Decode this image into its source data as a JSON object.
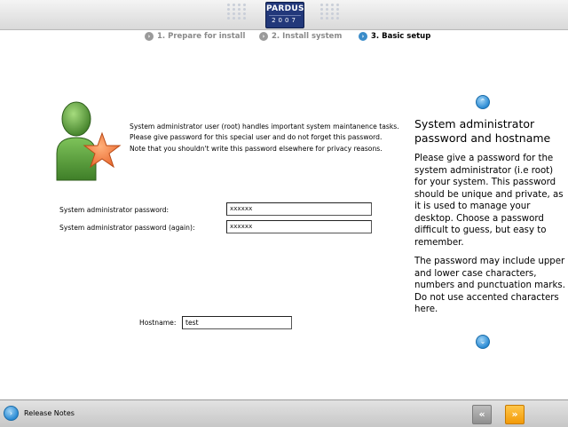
{
  "header": {
    "logo_name": "PARDUS",
    "logo_year": "2007"
  },
  "steps": [
    {
      "bullet": "›",
      "label": "1. Prepare for install"
    },
    {
      "bullet": "›",
      "label": "2. Install system"
    },
    {
      "bullet": "›",
      "label": "3. Basic setup"
    }
  ],
  "main": {
    "intro": "System administrator user (root) handles important system maintanence tasks. Please give password for this special user and do not forget this password. Note that you shouldn't write this password elsewhere for privacy reasons.",
    "password_label": "System administrator password:",
    "password_value": "xxxxxx",
    "password_again_label": "System administrator password (again):",
    "password_again_value": "xxxxxx",
    "hostname_label": "Hostname:",
    "hostname_value": "test"
  },
  "help": {
    "up_icon": "⌃",
    "down_icon": "⌄",
    "title": "System administrator password and hostname",
    "paragraph1": "Please give a password for the system administrator (i.e root) for your system. This password should be unique and private, as it is used to manage your desktop. Choose a password difficult to guess, but easy to remember.",
    "paragraph2": "The password may include upper and lower case characters, numbers and punctuation marks. Do not use accented characters here."
  },
  "footer": {
    "release_icon": "›",
    "release_notes": "Release Notes",
    "back_icon": "«",
    "next_icon": "»"
  },
  "colors": {
    "accent": "#2b8bd4",
    "next": "#f29a08"
  }
}
